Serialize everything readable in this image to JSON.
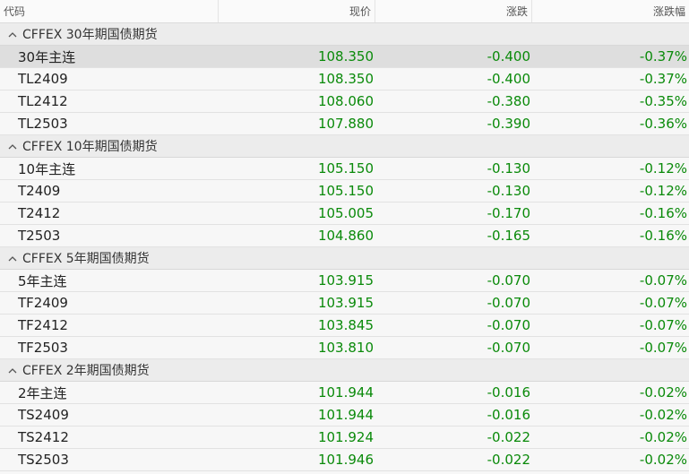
{
  "columns": {
    "code": "代码",
    "price": "现价",
    "change": "涨跌",
    "change_pct": "涨跌幅"
  },
  "colors": {
    "negative": "#0a8a0a",
    "selected_row": "#dedede"
  },
  "icons": {
    "group_toggle": "chevron-up-icon"
  },
  "groups": [
    {
      "title": "CFFEX 30年期国债期货",
      "rows": [
        {
          "code": "30年主连",
          "price": "108.350",
          "change": "-0.400",
          "change_pct": "-0.37%"
        },
        {
          "code": "TL2409",
          "price": "108.350",
          "change": "-0.400",
          "change_pct": "-0.37%"
        },
        {
          "code": "TL2412",
          "price": "108.060",
          "change": "-0.380",
          "change_pct": "-0.35%"
        },
        {
          "code": "TL2503",
          "price": "107.880",
          "change": "-0.390",
          "change_pct": "-0.36%"
        }
      ]
    },
    {
      "title": "CFFEX 10年期国债期货",
      "rows": [
        {
          "code": "10年主连",
          "price": "105.150",
          "change": "-0.130",
          "change_pct": "-0.12%"
        },
        {
          "code": "T2409",
          "price": "105.150",
          "change": "-0.130",
          "change_pct": "-0.12%"
        },
        {
          "code": "T2412",
          "price": "105.005",
          "change": "-0.170",
          "change_pct": "-0.16%"
        },
        {
          "code": "T2503",
          "price": "104.860",
          "change": "-0.165",
          "change_pct": "-0.16%"
        }
      ]
    },
    {
      "title": "CFFEX 5年期国债期货",
      "rows": [
        {
          "code": "5年主连",
          "price": "103.915",
          "change": "-0.070",
          "change_pct": "-0.07%"
        },
        {
          "code": "TF2409",
          "price": "103.915",
          "change": "-0.070",
          "change_pct": "-0.07%"
        },
        {
          "code": "TF2412",
          "price": "103.845",
          "change": "-0.070",
          "change_pct": "-0.07%"
        },
        {
          "code": "TF2503",
          "price": "103.810",
          "change": "-0.070",
          "change_pct": "-0.07%"
        }
      ]
    },
    {
      "title": "CFFEX 2年期国债期货",
      "rows": [
        {
          "code": "2年主连",
          "price": "101.944",
          "change": "-0.016",
          "change_pct": "-0.02%"
        },
        {
          "code": "TS2409",
          "price": "101.944",
          "change": "-0.016",
          "change_pct": "-0.02%"
        },
        {
          "code": "TS2412",
          "price": "101.924",
          "change": "-0.022",
          "change_pct": "-0.02%"
        },
        {
          "code": "TS2503",
          "price": "101.946",
          "change": "-0.022",
          "change_pct": "-0.02%"
        }
      ]
    }
  ]
}
